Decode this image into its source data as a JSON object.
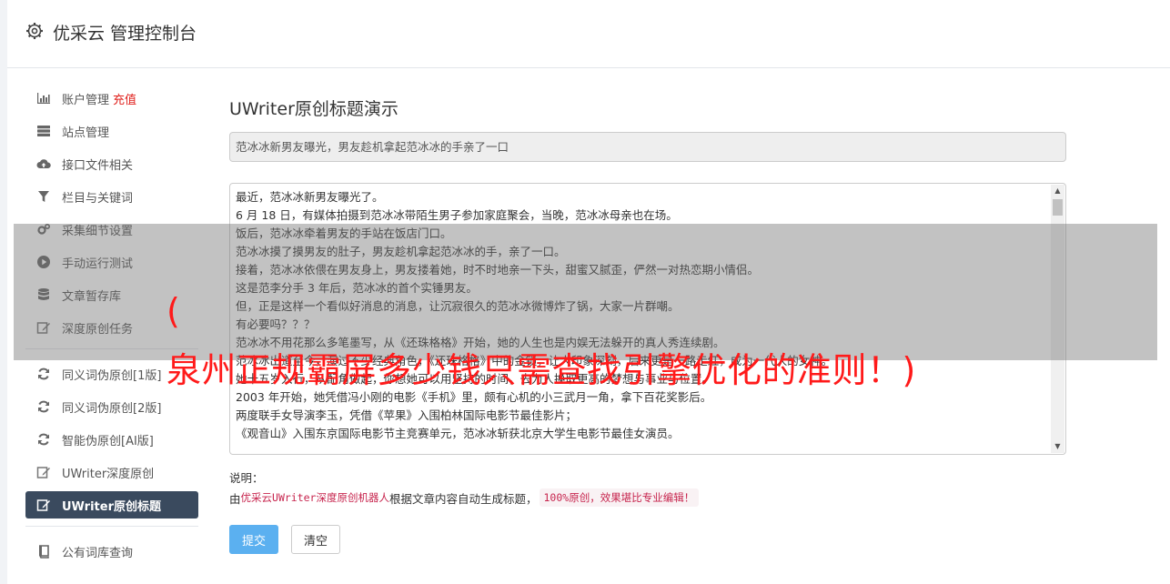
{
  "header": {
    "title": "优采云 管理控制台"
  },
  "sidebar": {
    "items": [
      {
        "label": "账户管理",
        "extra": "充值",
        "icon": "bar-chart-icon"
      },
      {
        "label": "站点管理",
        "icon": "server-icon"
      },
      {
        "label": "接口文件相关",
        "icon": "cloud-upload-icon"
      },
      {
        "label": "栏目与关键词",
        "icon": "filter-icon"
      },
      {
        "label": "采集细节设置",
        "icon": "gears-icon"
      },
      {
        "label": "手动运行测试",
        "icon": "play-icon"
      },
      {
        "label": "文章暂存库",
        "icon": "database-icon"
      },
      {
        "label": "深度原创任务",
        "icon": "edit-icon"
      }
    ],
    "items2": [
      {
        "label": "同义词伪原创[1版]",
        "icon": "refresh-icon"
      },
      {
        "label": "同义词伪原创[2版]",
        "icon": "refresh-icon"
      },
      {
        "label": "智能伪原创[AI版]",
        "icon": "refresh-icon"
      },
      {
        "label": "UWriter深度原创",
        "icon": "edit-icon"
      },
      {
        "label": "UWriter原创标题",
        "icon": "edit-icon",
        "active": true
      }
    ],
    "items3": [
      {
        "label": "公有词库查询",
        "icon": "book-icon"
      }
    ]
  },
  "main": {
    "title": "UWriter原创标题演示",
    "title_value": "范冰冰新男友曝光，男友趁机拿起范冰冰的手亲了一口",
    "body_lines": [
      "最近，范冰冰新男友曝光了。",
      "6 月 18 日，有媒体拍摄到范冰冰带陌生男子参加家庭聚会，当晚，范冰冰母亲也在场。",
      "饭后，范冰冰牵着男友的手站在饭店门口。",
      "范冰冰摸了摸男友的肚子，男友趁机拿起范冰冰的手，亲了一口。",
      "接着，范冰冰依偎在男友身上，男友搂着她，时不时地亲一下头，甜蜜又腻歪，俨然一对热恋期小情侣。",
      "这是范李分手 3 年后，范冰冰的首个实锤男友。",
      "但，正是这样一个看似好消息的消息，让沉寂很久的范冰冰微博炸了锅，大家一片群嘲。",
      "有必要吗？？？",
      "范冰冰不用花那么多笔墨写，从《还珠格格》开始，她的人生也是内娱无法躲开的真人秀连续剧。",
      "范冰冰出道至今，演过不少经典角色，《还珠格格》中的金锁，让人印象深刻，后来更是一路走红，成为一代人的女神。",
      "她十五岁入行，从配角做起，你想她可以用坚持的时间，去为人换取更高的梦想与事业与位置。",
      "2003 年开始，她凭借冯小刚的电影《手机》里，颇有心机的小三武月一角，拿下百花奖影后。",
      "两度联手女导演李玉，凭借《苹果》入围柏林国际电影节最佳影片；",
      "《观音山》入围东京国际电影节主竞赛单元，范冰冰斩获北京大学生电影节最佳女演员。"
    ],
    "note_label": "说明：",
    "note_prefix": "由 ",
    "note_code": "优采云UWriter深度原创机器人",
    "note_mid": " 根据文章内容自动生成标题，",
    "note_tag": "100%原创，效果堪比专业编辑！",
    "submit_label": "提交",
    "clear_label": "清空"
  },
  "overlay": {
    "open_paren": "(",
    "text": "泉州正规霸屏多少钱只需查找引擎优化的准则！)"
  },
  "colors": {
    "accent": "#5bb0f0",
    "active_nav": "#3a4a5e",
    "banner": "#ff1a1a",
    "recharge": "#e0201c"
  }
}
